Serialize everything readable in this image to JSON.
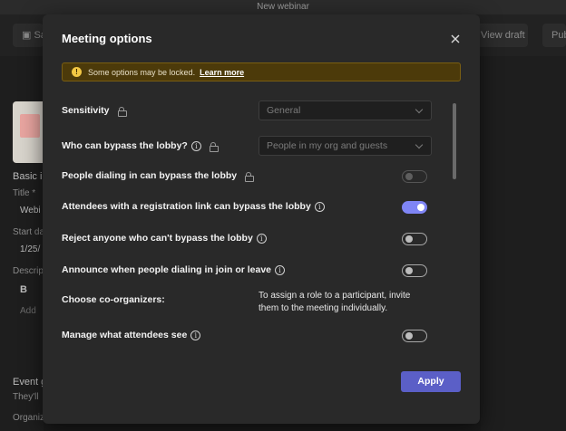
{
  "window": {
    "title": "New webinar"
  },
  "background": {
    "save_label": "Save",
    "view_draft_label": "View draft",
    "publish_label": "Publ",
    "basic_info": "Basic i",
    "title_label": "Title *",
    "title_value": "Webi",
    "start_date_label": "Start da",
    "start_date_value": "1/25/",
    "description_label": "Descript",
    "bold_label": "B",
    "add_label": "Add",
    "event_label": "Event g",
    "theyll_label": "They'll",
    "organizer_label": "Organiz"
  },
  "modal": {
    "title": "Meeting options",
    "banner": {
      "text": "Some options may be locked.",
      "link": "Learn more"
    },
    "options": {
      "sensitivity": {
        "label": "Sensitivity",
        "value": "General"
      },
      "bypass_lobby": {
        "label": "Who can bypass the lobby?",
        "value": "People in my org and guests"
      },
      "dial_in_bypass": {
        "label": "People dialing in can bypass the lobby",
        "enabled": false
      },
      "registration_bypass": {
        "label": "Attendees with a registration link can bypass the lobby",
        "enabled": true
      },
      "reject": {
        "label": "Reject anyone who can't bypass the lobby",
        "enabled": false
      },
      "announce": {
        "label": "Announce when people dialing in join or leave",
        "enabled": false
      },
      "coorganizers": {
        "label": "Choose co-organizers:",
        "note": "To assign a role to a participant, invite them to the meeting individually."
      },
      "manage_attendees": {
        "label": "Manage what attendees see",
        "enabled": false
      }
    },
    "apply_label": "Apply"
  },
  "colors": {
    "accent": "#5b5fc7",
    "toggle_on": "#7f85f5",
    "banner_bg": "#4c3a0a",
    "warning": "#f2c744"
  }
}
